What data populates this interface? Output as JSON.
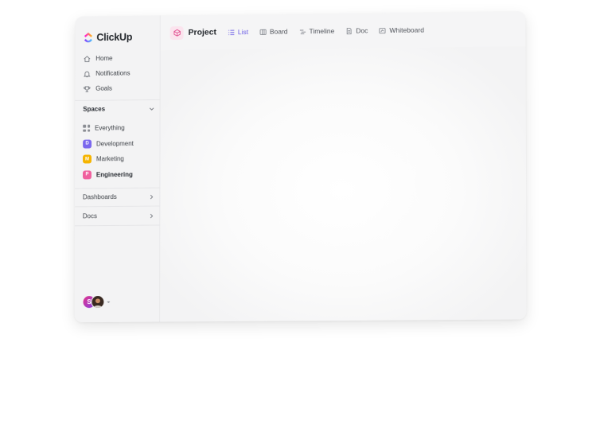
{
  "brand": {
    "name": "ClickUp"
  },
  "nav": [
    {
      "label": "Home",
      "icon": "home-icon"
    },
    {
      "label": "Notifications",
      "icon": "bell-icon"
    },
    {
      "label": "Goals",
      "icon": "trophy-icon"
    }
  ],
  "spaces": {
    "heading": "Spaces",
    "items": [
      {
        "label": "Everything",
        "icon": "grid-icon"
      },
      {
        "label": "Development",
        "badge": "D",
        "color": "#7b68ee"
      },
      {
        "label": "Marketing",
        "badge": "M",
        "color": "#f5b400"
      },
      {
        "label": "Engineering",
        "badge": "P",
        "color": "#f0609e",
        "active": true
      }
    ]
  },
  "dashboards": {
    "label": "Dashboards"
  },
  "docs": {
    "label": "Docs"
  },
  "users": {
    "avatar1": "S"
  },
  "header": {
    "project": "Project",
    "tabs": [
      {
        "label": "List",
        "icon": "list-icon",
        "active": true
      },
      {
        "label": "Board",
        "icon": "board-icon"
      },
      {
        "label": "Timeline",
        "icon": "timeline-icon"
      },
      {
        "label": "Doc",
        "icon": "doc-icon"
      },
      {
        "label": "Whiteboard",
        "icon": "whiteboard-icon"
      }
    ]
  },
  "colors": {
    "accent": "#6b5de6",
    "project_icon_bg": "#fbe4ee",
    "project_icon": "#e0468a"
  }
}
